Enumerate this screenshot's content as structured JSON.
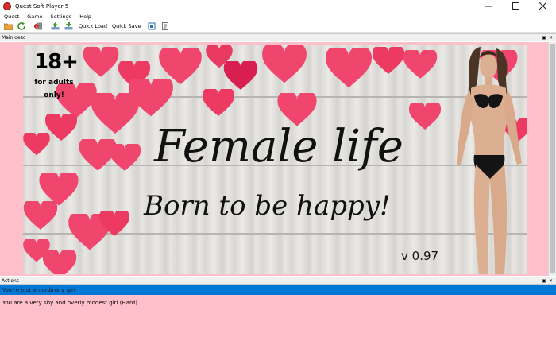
{
  "window": {
    "title": "Quest Soft Player 5"
  },
  "menu": [
    "Quest",
    "Game",
    "Settings",
    "Help"
  ],
  "toolbar": {
    "quick_load": "Quick Load",
    "quick_save": "Quick Save"
  },
  "main_desc": {
    "header": "Main desc",
    "banner": {
      "age_rating": "18+",
      "age_line1": "for adults",
      "age_line2": "only!",
      "title": "Female life",
      "subtitle": "Born to be happy!",
      "version": "v 0.97"
    }
  },
  "actions": {
    "header": "Actions",
    "items": [
      {
        "label": "You're just an ordinary girl",
        "selected": true
      },
      {
        "label": "You are a very shy and overly modest girl (Hard)",
        "selected": false
      }
    ]
  },
  "colors": {
    "panel_bg": "#ffc0cb",
    "selection": "#0078d7",
    "heart": "#f0466e"
  }
}
